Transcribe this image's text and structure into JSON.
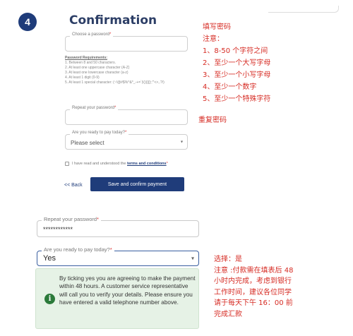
{
  "step_number": "4",
  "title": "Confirmation",
  "password_field": {
    "label": "Choose a password",
    "required_mark": "*"
  },
  "password_requirements": {
    "title": "Password Requirements:",
    "items": [
      "1. Between 8 and 50 characters.",
      "2. At least one uppercase character (A-Z)",
      "3. At least one lowercase character (a-z)",
      "4. At least 1 digit (0-9)",
      "5. At least 1 special character: (~!@#$%^&*_-+=`|\\(){}[]:;\"'<>,.?/)"
    ]
  },
  "repeat_password_field": {
    "label": "Repeat your password",
    "required_mark": "*"
  },
  "ready_to_pay_field": {
    "label": "Are you ready to pay today?",
    "required_mark": "*",
    "selected": "Please select"
  },
  "terms": {
    "prefix": "I have read and understood the ",
    "link": "terms and conditions",
    "suffix": "*"
  },
  "back_link": "<< Back",
  "confirm_button": "Save and confirm payment",
  "annotation_password": {
    "lines": [
      "填写密码",
      "注意：",
      "1、8-50 个字符之间",
      "2、至少一个大写字母",
      "3、至少一个小写字母",
      "4、至少一个数字",
      "5、至少一个特殊字符"
    ]
  },
  "annotation_repeat": "重复密码",
  "zoom_repeat_field": {
    "label": "Repeat your password",
    "required_mark": "*",
    "value": "************"
  },
  "zoom_ready_field": {
    "label": "Are you ready to pay today?",
    "required_mark": "*",
    "selected": "Yes"
  },
  "notice_text": "By ticking yes you are agreeing to make the payment within 48 hours. A customer service representative will call you to verify your details. Please ensure you have entered a valid telephone number above.",
  "annotation_select": {
    "lines": [
      "选择：是",
      "注意 :付款需在填表后 48",
      "小时内完成，考虑到银行",
      "工作时间，建议各位同学",
      "请于每天下午 16：00 前",
      "完成汇款"
    ]
  },
  "colors": {
    "primary": "#1f3c7a",
    "annotation_red": "#d62b23",
    "notice_bg": "#e6f2e6",
    "info_green": "#2b7a3a"
  }
}
